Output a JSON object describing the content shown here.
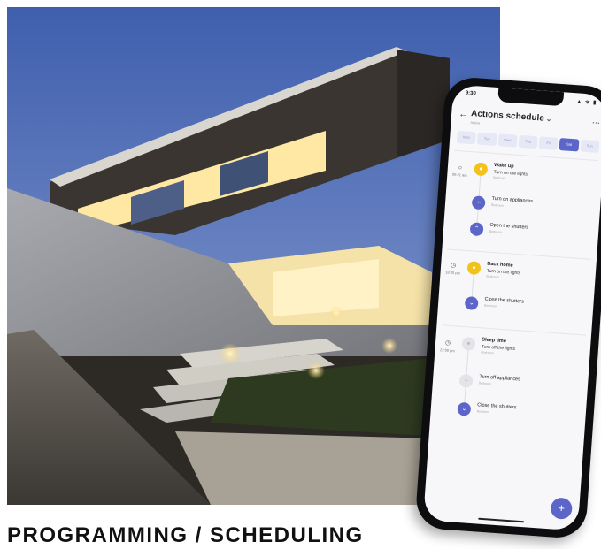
{
  "caption": "PROGRAMMING / SCHEDULING",
  "phone": {
    "status": {
      "time": "9:30",
      "icons": "▲ ᯤ ▮"
    },
    "header": {
      "title": "Actions schedule",
      "subtitle": "Active"
    },
    "days": [
      "Mon",
      "Tue",
      "Wed",
      "Thu",
      "Fri",
      "Sat",
      "Sun"
    ],
    "active_day": "Sat",
    "sections": [
      {
        "time": "06:21 am",
        "items": [
          {
            "title": "Wake up",
            "action": "Turn on the lights",
            "sub": "Bedroom",
            "color": "yellow",
            "icon": "bulb-icon"
          },
          {
            "title": "",
            "action": "Turn on appliances",
            "sub": "Bedroom",
            "color": "purple",
            "icon": "plug-icon"
          },
          {
            "title": "",
            "action": "Open the shutters",
            "sub": "Bedroom",
            "color": "purple",
            "icon": "shutter-up-icon"
          }
        ]
      },
      {
        "time": "18:00 pm",
        "items": [
          {
            "title": "Back home",
            "action": "Turn on the lights",
            "sub": "Bedroom",
            "color": "yellow",
            "icon": "bulb-icon"
          },
          {
            "title": "",
            "action": "Close the shutters",
            "sub": "Bedroom",
            "color": "purple",
            "icon": "shutter-down-icon"
          }
        ]
      },
      {
        "time": "22:00 pm",
        "items": [
          {
            "title": "Sleep time",
            "action": "Turn off the lights",
            "sub": "Bedroom",
            "color": "grey",
            "icon": "bulb-off-icon"
          },
          {
            "title": "",
            "action": "Turn off appliances",
            "sub": "Bedroom",
            "color": "grey",
            "icon": "plug-off-icon"
          },
          {
            "title": "",
            "action": "Close the shutters",
            "sub": "Bedroom",
            "color": "purple",
            "icon": "shutter-down-icon"
          }
        ]
      }
    ],
    "fab": "+",
    "colors": {
      "accent": "#5c66c8",
      "yellow": "#f2c21b"
    }
  }
}
